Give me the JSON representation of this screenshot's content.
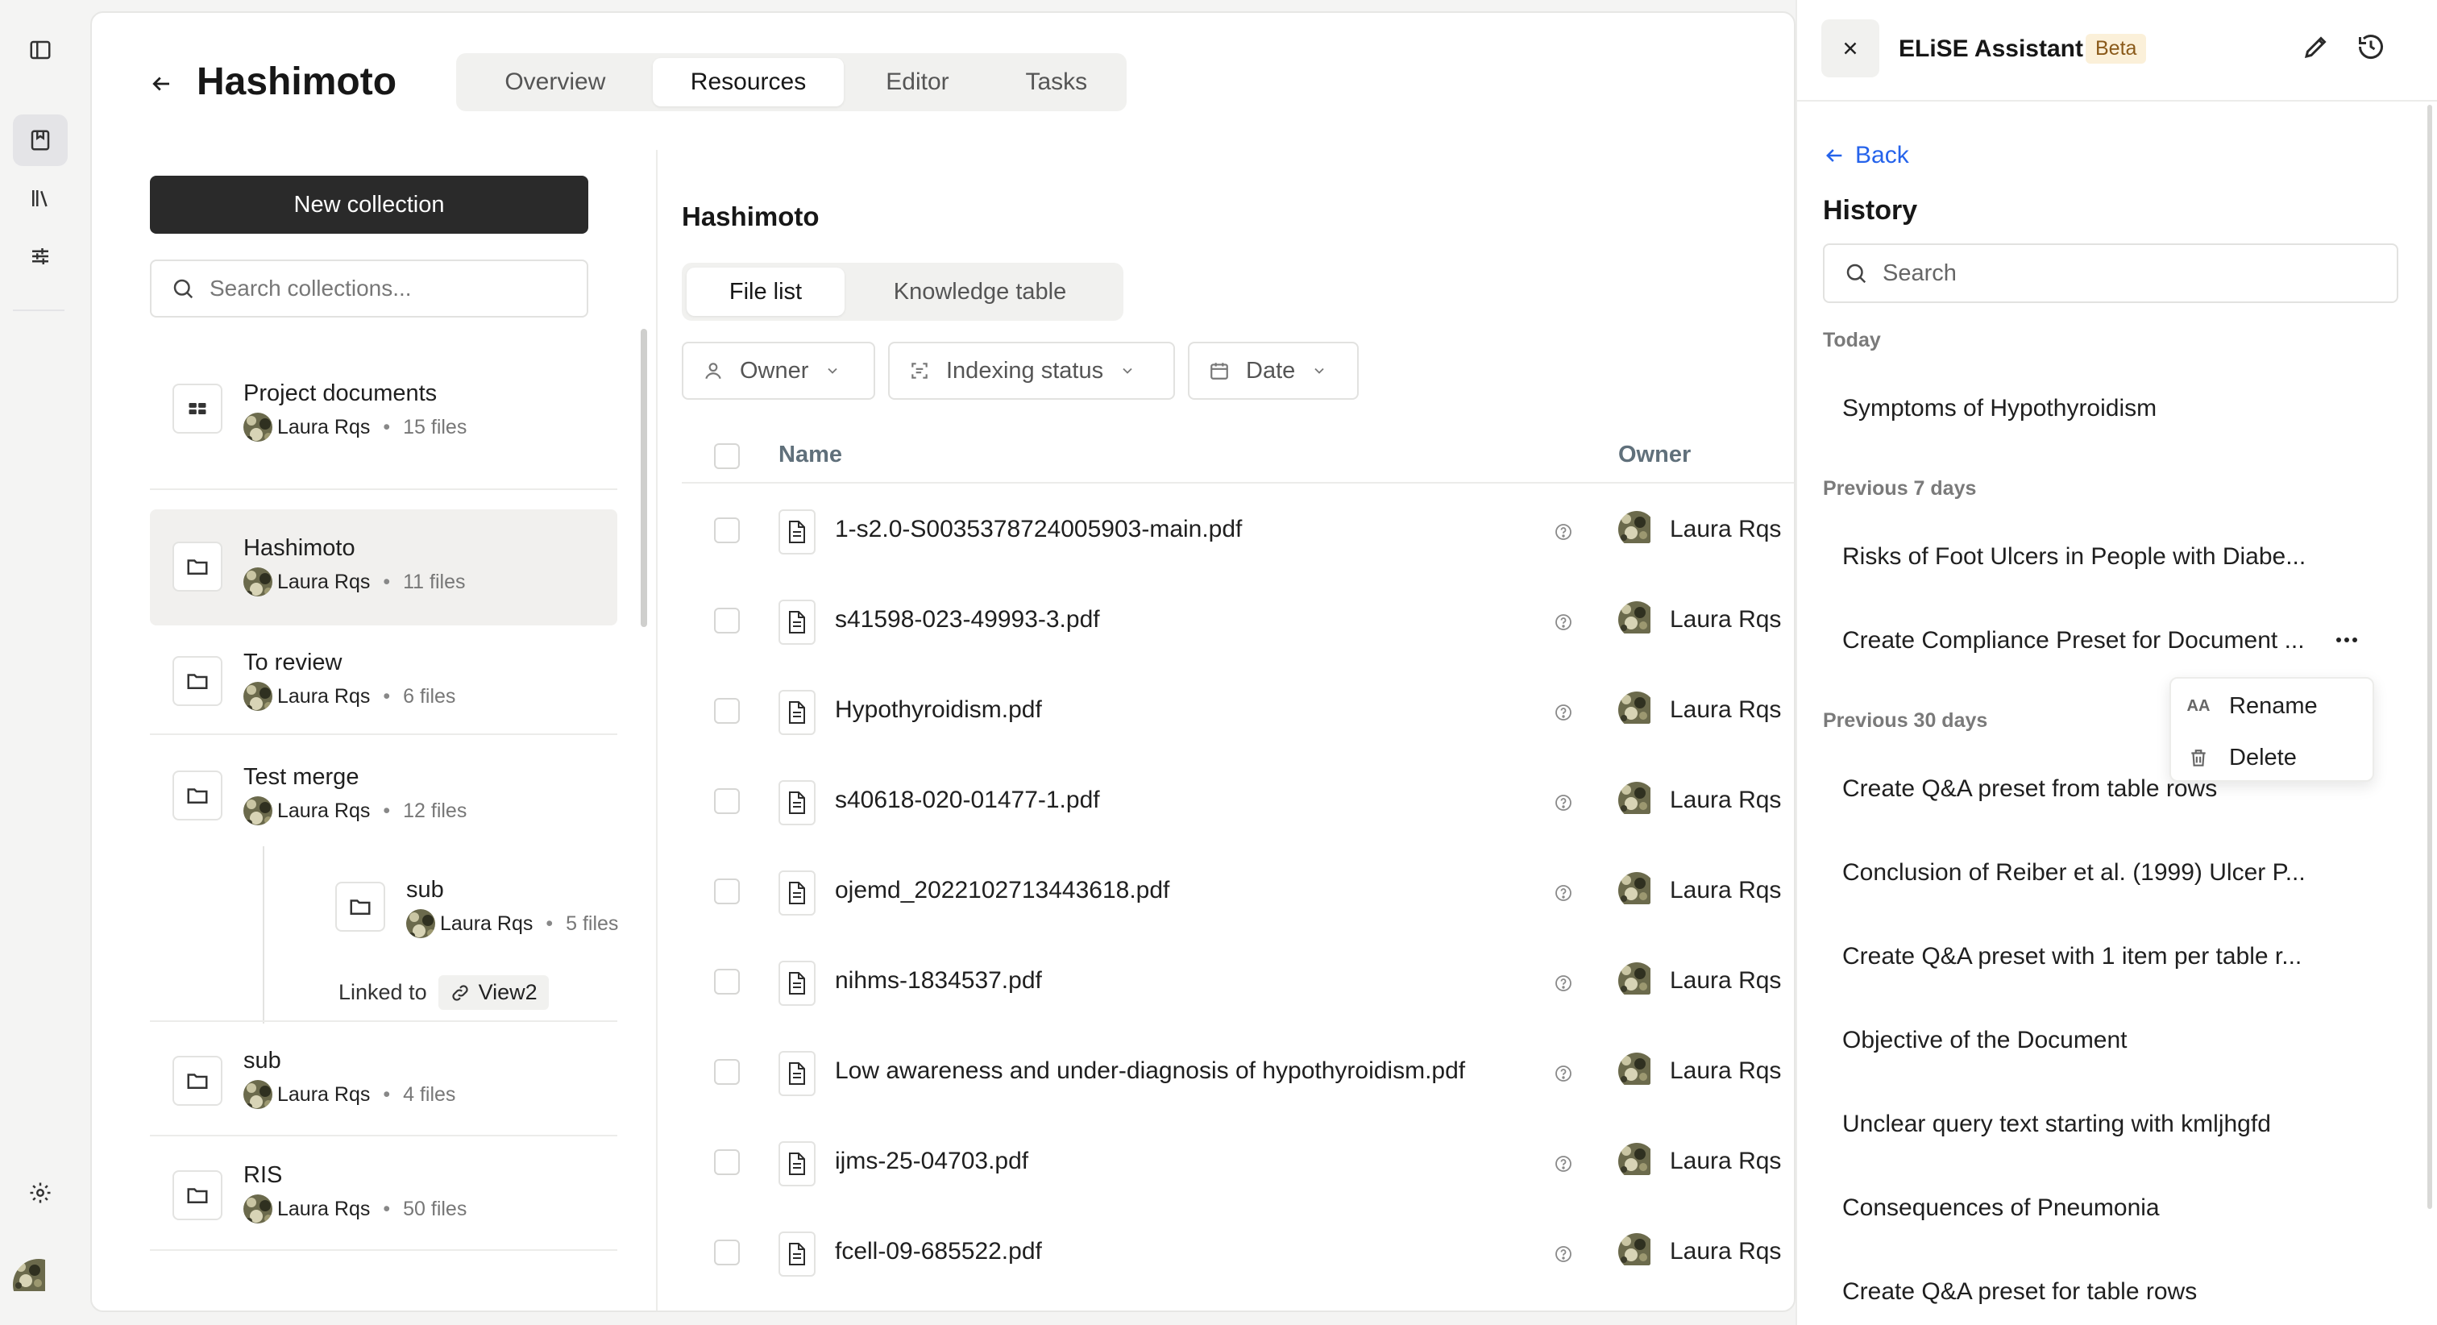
{
  "project": {
    "title": "Hashimoto",
    "tabs": [
      {
        "label": "Overview"
      },
      {
        "label": "Resources"
      },
      {
        "label": "Editor"
      },
      {
        "label": "Tasks"
      }
    ],
    "active_tab": "Resources"
  },
  "collections": {
    "new_button": "New collection",
    "search_placeholder": "Search collections...",
    "items": [
      {
        "name": "Project documents",
        "owner": "Laura Rqs",
        "count": "15 files",
        "icon": "grid-icon"
      },
      {
        "name": "Hashimoto",
        "owner": "Laura Rqs",
        "count": "11 files",
        "icon": "folder-icon"
      },
      {
        "name": "To review",
        "owner": "Laura Rqs",
        "count": "6 files",
        "icon": "folder-icon"
      },
      {
        "name": "Test merge",
        "owner": "Laura Rqs",
        "count": "12 files",
        "icon": "folder-icon"
      },
      {
        "name": "sub",
        "owner": "Laura Rqs",
        "count": "5 files",
        "icon": "folder-icon"
      },
      {
        "name": "sub",
        "owner": "Laura Rqs",
        "count": "4 files",
        "icon": "folder-icon"
      },
      {
        "name": "RIS",
        "owner": "Laura Rqs",
        "count": "50 files",
        "icon": "folder-icon"
      }
    ],
    "linked_label": "Linked to",
    "linked_view": "View2",
    "selected": "Hashimoto"
  },
  "file_pane": {
    "title": "Hashimoto",
    "subtabs": [
      {
        "label": "File list"
      },
      {
        "label": "Knowledge table"
      }
    ],
    "active_subtab": "File list",
    "filters": [
      {
        "label": "Owner",
        "icon": "person-icon"
      },
      {
        "label": "Indexing status",
        "icon": "scan-icon"
      },
      {
        "label": "Date",
        "icon": "calendar-icon"
      }
    ],
    "columns": {
      "name": "Name",
      "owner": "Owner"
    },
    "files": [
      {
        "name": "1-s2.0-S0035378724005903-main.pdf",
        "owner": "Laura Rqs"
      },
      {
        "name": "s41598-023-49993-3.pdf",
        "owner": "Laura Rqs"
      },
      {
        "name": "Hypothyroidism.pdf",
        "owner": "Laura Rqs"
      },
      {
        "name": "s40618-020-01477-1.pdf",
        "owner": "Laura Rqs"
      },
      {
        "name": "ojemd_2022102713443618.pdf",
        "owner": "Laura Rqs"
      },
      {
        "name": "nihms-1834537.pdf",
        "owner": "Laura Rqs"
      },
      {
        "name": "Low awareness and under-diagnosis of hypothyroidism.pdf",
        "owner": "Laura Rqs"
      },
      {
        "name": "ijms-25-04703.pdf",
        "owner": "Laura Rqs"
      },
      {
        "name": "fcell-09-685522.pdf",
        "owner": "Laura Rqs"
      }
    ]
  },
  "assistant": {
    "title": "ELiSE Assistant",
    "badge": "Beta",
    "back": "Back",
    "history_title": "History",
    "search_placeholder": "Search",
    "groups": [
      {
        "label": "Today",
        "items": [
          "Symptoms of Hypothyroidism"
        ]
      },
      {
        "label": "Previous 7 days",
        "items": [
          "Risks of Foot Ulcers in People with Diabe...",
          "Create Compliance Preset for Document ..."
        ]
      },
      {
        "label": "Previous 30 days",
        "items": [
          "Create Q&A preset from table rows",
          "Conclusion of Reiber et al. (1999) Ulcer P...",
          "Create Q&A preset with 1 item per table r...",
          "Objective of the Document",
          "Unclear query text starting with kmljhgfd",
          "Consequences of Pneumonia",
          "Create Q&A preset for table rows"
        ]
      }
    ],
    "context_menu": {
      "rename": "Rename",
      "rename_icon": "AA",
      "delete": "Delete"
    }
  },
  "colors": {
    "accent_link": "#2563eb",
    "primary_button": "#2a2a2a",
    "beta_bg": "#fbf0d9",
    "selected_row": "#f1f0ee"
  }
}
